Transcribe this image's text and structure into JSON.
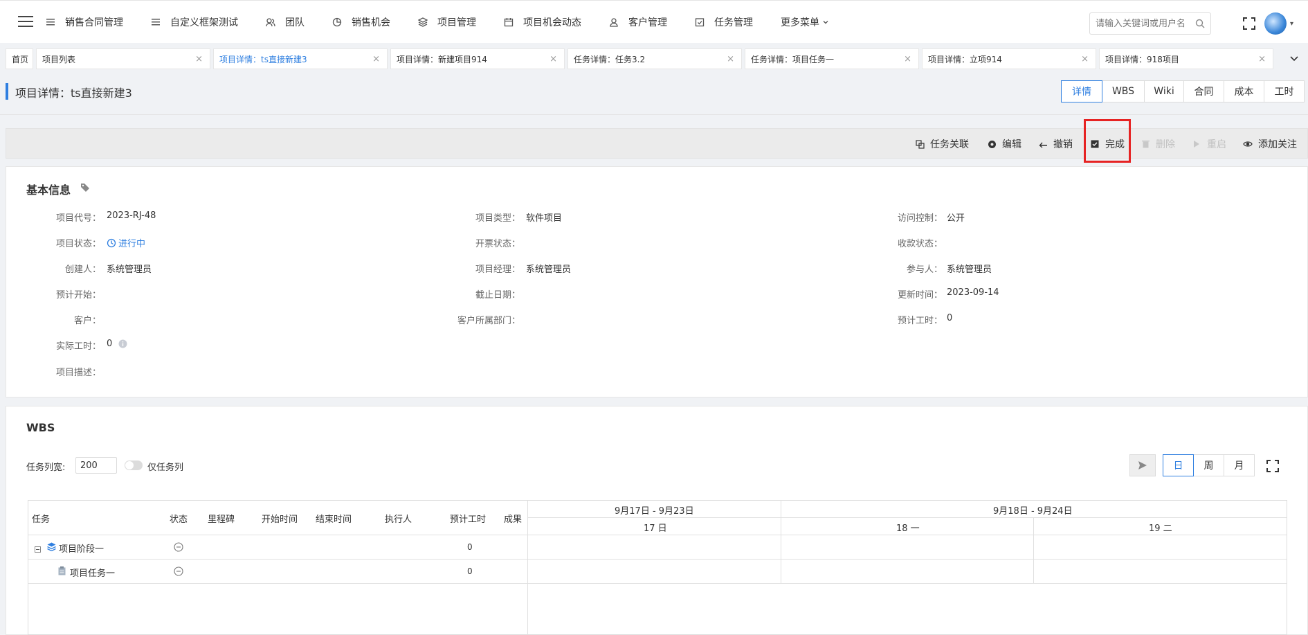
{
  "nav": {
    "items": [
      {
        "label": "销售合同管理",
        "icon": "menu-lines-icon"
      },
      {
        "label": "自定义框架测试",
        "icon": "menu-lines-icon"
      },
      {
        "label": "团队",
        "icon": "team-icon"
      },
      {
        "label": "销售机会",
        "icon": "pie-chart-icon"
      },
      {
        "label": "项目管理",
        "icon": "layers-icon"
      },
      {
        "label": "项目机会动态",
        "icon": "calendar-icon"
      },
      {
        "label": "客户管理",
        "icon": "user-icon"
      },
      {
        "label": "任务管理",
        "icon": "checkbox-calendar-icon"
      },
      {
        "label": "更多菜单",
        "icon": "chevron-down-icon"
      }
    ],
    "search_placeholder": "请输入关键词或用户名"
  },
  "tabs": [
    {
      "label": "首页"
    },
    {
      "label": "项目列表"
    },
    {
      "label": "项目详情：ts直接新建3",
      "active": true
    },
    {
      "label": "项目详情：新建项目914"
    },
    {
      "label": "任务详情：任务3.2"
    },
    {
      "label": "任务详情：项目任务一"
    },
    {
      "label": "项目详情：立项914"
    },
    {
      "label": "项目详情：918项目"
    }
  ],
  "page": {
    "title": "项目详情：ts直接新建3",
    "view_tabs": [
      "详情",
      "WBS",
      "Wiki",
      "合同",
      "成本",
      "工时"
    ],
    "active_view": "详情"
  },
  "toolbar": {
    "actions": [
      {
        "label": "任务关联",
        "icon": "link-copy-icon",
        "enabled": true
      },
      {
        "label": "编辑",
        "icon": "gear-icon",
        "enabled": true
      },
      {
        "label": "撤销",
        "icon": "undo-icon",
        "enabled": true
      },
      {
        "label": "完成",
        "icon": "checkbox-icon",
        "enabled": true,
        "highlighted": true
      },
      {
        "label": "删除",
        "icon": "trash-icon",
        "enabled": false
      },
      {
        "label": "重启",
        "icon": "play-icon",
        "enabled": false
      },
      {
        "label": "添加关注",
        "icon": "eye-icon",
        "enabled": true
      }
    ]
  },
  "basic_info": {
    "title": "基本信息",
    "fields": {
      "code": {
        "label": "项目代号：",
        "value": "2023-RJ-48"
      },
      "type": {
        "label": "项目类型：",
        "value": "软件项目"
      },
      "access": {
        "label": "访问控制：",
        "value": "公开"
      },
      "status": {
        "label": "项目状态：",
        "value": "进行中"
      },
      "invoice": {
        "label": "开票状态：",
        "value": ""
      },
      "payment": {
        "label": "收款状态：",
        "value": ""
      },
      "creator": {
        "label": "创建人：",
        "value": "系统管理员"
      },
      "manager": {
        "label": "项目经理：",
        "value": "系统管理员"
      },
      "participant": {
        "label": "参与人：",
        "value": "系统管理员"
      },
      "plan_start": {
        "label": "预计开始：",
        "value": ""
      },
      "deadline": {
        "label": "截止日期：",
        "value": ""
      },
      "updated": {
        "label": "更新时间：",
        "value": "2023-09-14"
      },
      "customer": {
        "label": "客户：",
        "value": ""
      },
      "customer_dept": {
        "label": "客户所属部门：",
        "value": ""
      },
      "plan_hours": {
        "label": "预计工时：",
        "value": "0"
      },
      "actual_hours": {
        "label": "实际工时：",
        "value": "0"
      },
      "description": {
        "label": "项目描述：",
        "value": ""
      }
    }
  },
  "wbs": {
    "title": "WBS",
    "col_width_label": "任务列宽:",
    "col_width_value": "200",
    "task_only_label": "仅任务列",
    "scale_buttons": [
      "日",
      "周",
      "月"
    ],
    "active_scale": "日",
    "columns": [
      "任务",
      "状态",
      "里程碑",
      "开始时间",
      "结束时间",
      "执行人",
      "预计工时",
      "成果"
    ],
    "weeks": [
      "9月17日 - 9月23日",
      "9月18日 - 9月24日"
    ],
    "days": [
      "17 日",
      "18 一",
      "19 二"
    ],
    "rows": [
      {
        "name": "项目阶段一",
        "hours": "0",
        "type": "phase"
      },
      {
        "name": "项目任务一",
        "hours": "0",
        "type": "task"
      }
    ]
  }
}
